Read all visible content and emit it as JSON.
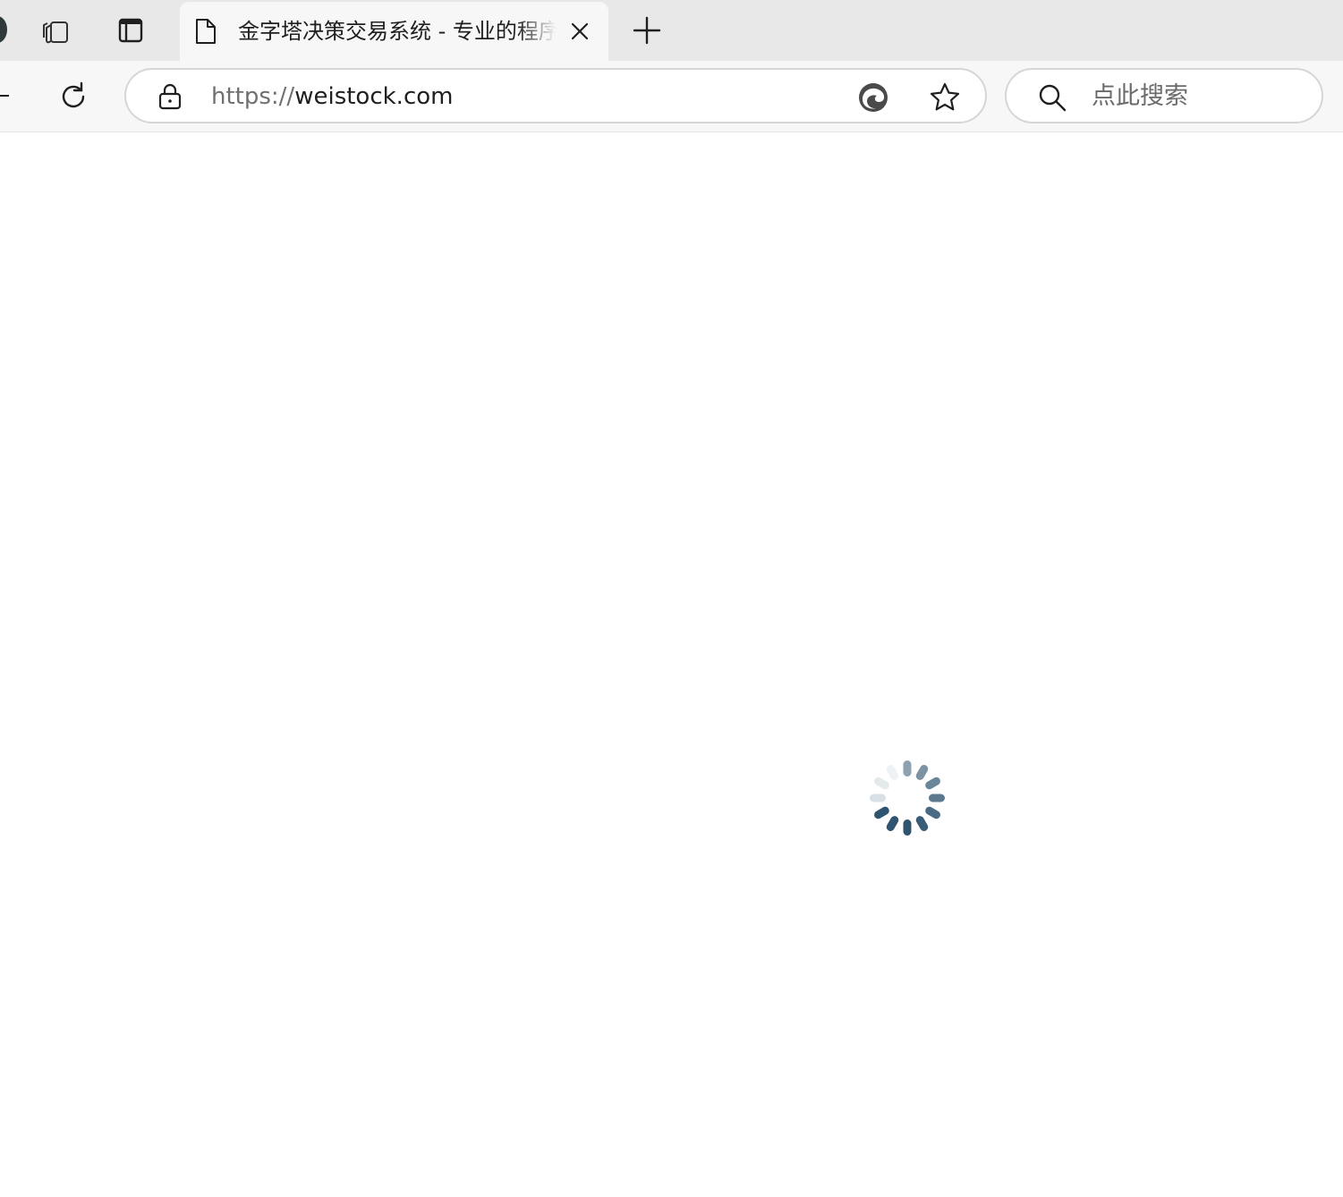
{
  "tab": {
    "title": "金字塔决策交易系统  -  专业的程序化交易平台"
  },
  "address_bar": {
    "scheme": "https://",
    "host": "weistock.com"
  },
  "search": {
    "placeholder": "点此搜索"
  },
  "icons": {
    "profile": "profile-avatar",
    "workspaces": "workspaces-icon",
    "vertical_tabs": "vertical-tabs-icon",
    "favicon": "page-icon",
    "close": "close-icon",
    "new_tab": "plus-icon",
    "back": "back-arrow-icon",
    "refresh": "refresh-icon",
    "lock": "lock-icon",
    "edge": "edge-icon",
    "favorite": "star-icon",
    "search": "search-icon",
    "loading": "loading-spinner"
  },
  "colors": {
    "tabstrip_bg": "#e8e8e8",
    "toolbar_bg": "#f7f7f7",
    "spinner": "#2f5470"
  }
}
